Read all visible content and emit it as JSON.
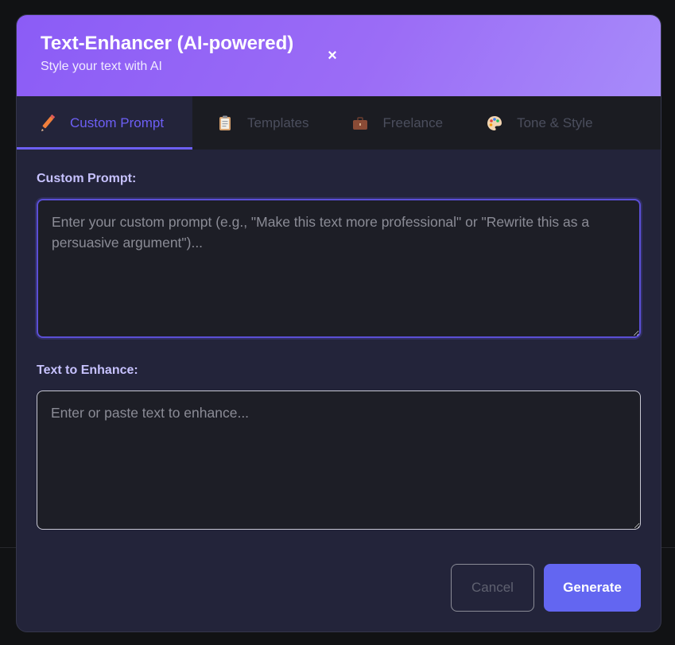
{
  "header": {
    "title": "Text-Enhancer (AI-powered)",
    "subtitle": "Style your text with AI",
    "close_label": "×"
  },
  "tabs": [
    {
      "label": "Custom Prompt",
      "icon": "pencil-icon",
      "active": true
    },
    {
      "label": "Templates",
      "icon": "clipboard-icon",
      "active": false
    },
    {
      "label": "Freelance",
      "icon": "briefcase-icon",
      "active": false
    },
    {
      "label": "Tone & Style",
      "icon": "palette-icon",
      "active": false
    }
  ],
  "form": {
    "prompt_label": "Custom Prompt:",
    "prompt_placeholder": "Enter your custom prompt (e.g., \"Make this text more professional\" or \"Rewrite this as a persuasive argument\")...",
    "prompt_value": "",
    "text_label": "Text to Enhance:",
    "text_placeholder": "Enter or paste text to enhance...",
    "text_value": ""
  },
  "footer": {
    "cancel_label": "Cancel",
    "generate_label": "Generate"
  },
  "colors": {
    "accent": "#6366f1",
    "header_gradient_start": "#8b5cf6",
    "header_gradient_end": "#a78bfa",
    "active_tab": "#6d5ff5"
  }
}
